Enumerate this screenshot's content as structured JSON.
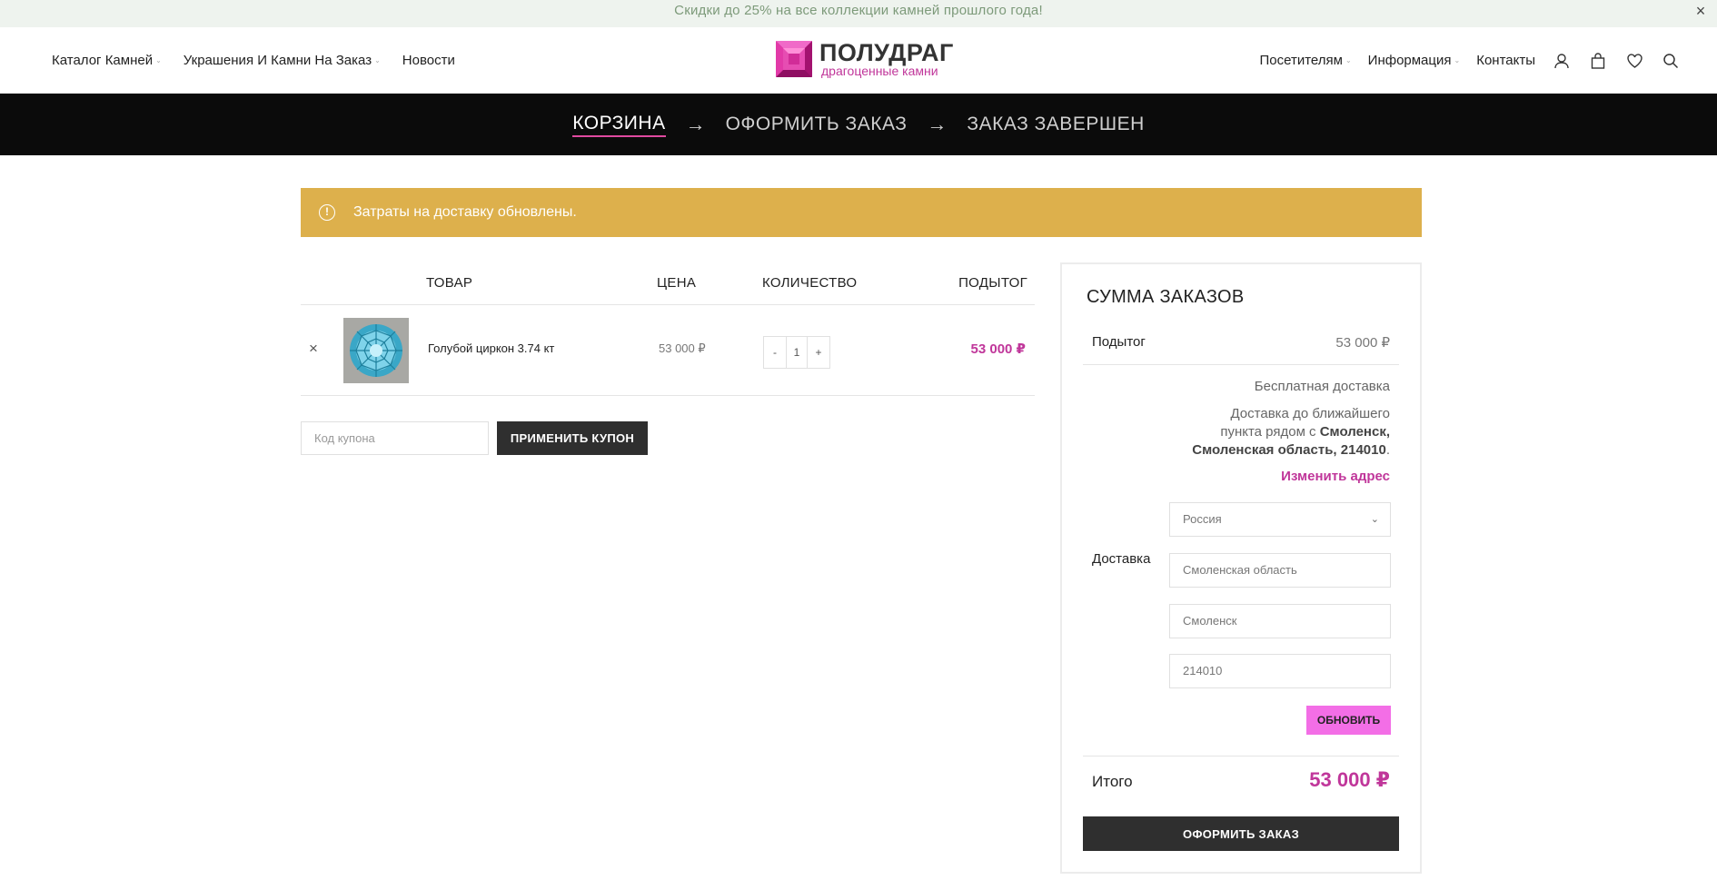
{
  "promo": {
    "text": "Скидки до 25% на все коллекции камней прошлого года!",
    "close": "×"
  },
  "header": {
    "nav_left": [
      {
        "label": "Каталог Камней",
        "has_dropdown": true
      },
      {
        "label": "Украшения И Камни На Заказ",
        "has_dropdown": true
      },
      {
        "label": "Новости",
        "has_dropdown": false
      }
    ],
    "logo": {
      "title": "ПОЛУДРАГ",
      "subtitle": "драгоценные камни"
    },
    "nav_right": [
      {
        "label": "Посетителям",
        "has_dropdown": true
      },
      {
        "label": "Информация",
        "has_dropdown": true
      },
      {
        "label": "Контакты",
        "has_dropdown": false
      }
    ],
    "icons": [
      "user-icon",
      "cart-icon",
      "heart-icon",
      "search-icon"
    ]
  },
  "steps": {
    "cart": "КОРЗИНА",
    "checkout": "ОФОРМИТЬ ЗАКАЗ",
    "complete": "ЗАКАЗ ЗАВЕРШЕН",
    "arrow": "→"
  },
  "notice": {
    "icon": "!",
    "text": "Затраты на доставку обновлены."
  },
  "cart": {
    "headers": {
      "product": "ТОВАР",
      "price": "ЦЕНА",
      "quantity": "КОЛИЧЕСТВО",
      "subtotal": "ПОДЫТОГ"
    },
    "items": [
      {
        "remove": "×",
        "name": "Голубой циркон 3.74 кт",
        "price": "53 000 ₽",
        "qty_minus": "-",
        "qty": "1",
        "qty_plus": "+",
        "subtotal": "53 000 ₽"
      }
    ],
    "coupon": {
      "placeholder": "Код купона",
      "button": "ПРИМЕНИТЬ КУПОН"
    }
  },
  "totals": {
    "title": "СУММА ЗАКАЗОВ",
    "subtotal_label": "Подытог",
    "subtotal_value": "53 000 ₽",
    "shipping_label": "Доставка",
    "shipping_method": "Бесплатная доставка",
    "shipping_dest_line1": "Доставка до ближайшего",
    "shipping_dest_line2": "пункта рядом с ",
    "shipping_dest_bold1": "Смоленск,",
    "shipping_dest_bold2": "Смоленская область, 214010",
    "shipping_dest_end": ".",
    "change_address": "Изменить адрес",
    "country": "Россия",
    "region": "Смоленская область",
    "city": "Смоленск",
    "postcode": "214010",
    "update_button": "ОБНОВИТЬ",
    "total_label": "Итого",
    "total_value": "53 000 ₽",
    "checkout_button": "ОФОРМИТЬ ЗАКАЗ"
  },
  "colors": {
    "accent": "#c0369a",
    "notice": "#ddb04c",
    "steps_bg": "#0b0b0b",
    "update_button": "#f36ee6"
  }
}
